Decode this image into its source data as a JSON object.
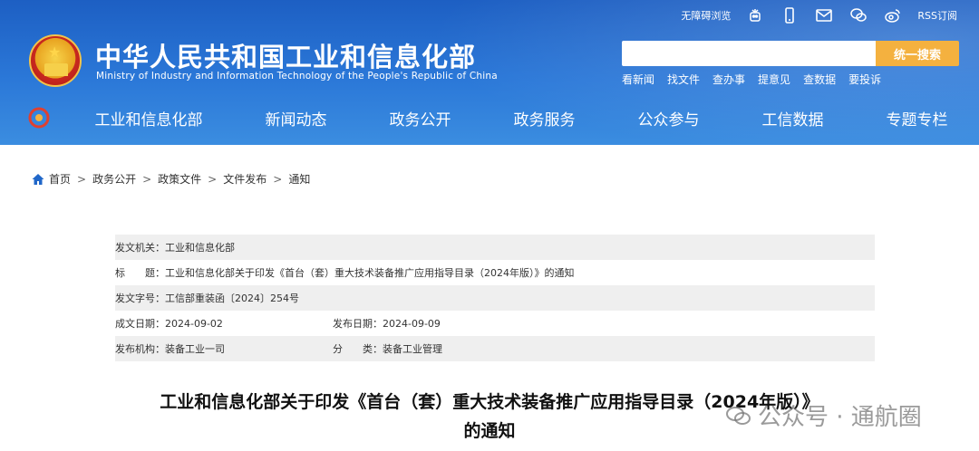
{
  "header": {
    "site_title": "中华人民共和国工业和信息化部",
    "site_subtitle": "Ministry of Industry and Information Technology of the People's Republic of China",
    "top_links": {
      "accessibility": "无障碍浏览",
      "rss": "RSS订阅"
    },
    "search": {
      "placeholder": "",
      "button_label": "统一搜索"
    },
    "quick_links": [
      "看新闻",
      "找文件",
      "查办事",
      "提意见",
      "查数据",
      "要投诉"
    ]
  },
  "nav": {
    "items": [
      "工业和信息化部",
      "新闻动态",
      "政务公开",
      "政务服务",
      "公众参与",
      "工信数据",
      "专题专栏"
    ]
  },
  "breadcrumb": [
    "首页",
    "政务公开",
    "政策文件",
    "文件发布",
    "通知"
  ],
  "info": {
    "issuer_label": "发文机关：",
    "issuer": "工业和信息化部",
    "title_label": "标　　题：",
    "title": "工业和信息化部关于印发《首台（套）重大技术装备推广应用指导目录（2024年版）》的通知",
    "doc_no_label": "发文字号：",
    "doc_no": "工信部重装函〔2024〕254号",
    "date_label": "成文日期：",
    "date": "2024-09-02",
    "pub_date_label": "发布日期：",
    "pub_date": "2024-09-09",
    "agency_label": "发布机构：",
    "agency": "装备工业一司",
    "category_label": "分　　类：",
    "category": "装备工业管理"
  },
  "doc_title": {
    "line1": "工业和信息化部关于印发《首台（套）重大技术装备推广应用指导目录（2024年版）》",
    "line2": "的通知"
  },
  "watermark": "公众号 · 通航圈",
  "colors": {
    "header_blue": "#2b78d8",
    "search_button": "#f4b13f",
    "link_blue": "#2067c9"
  }
}
